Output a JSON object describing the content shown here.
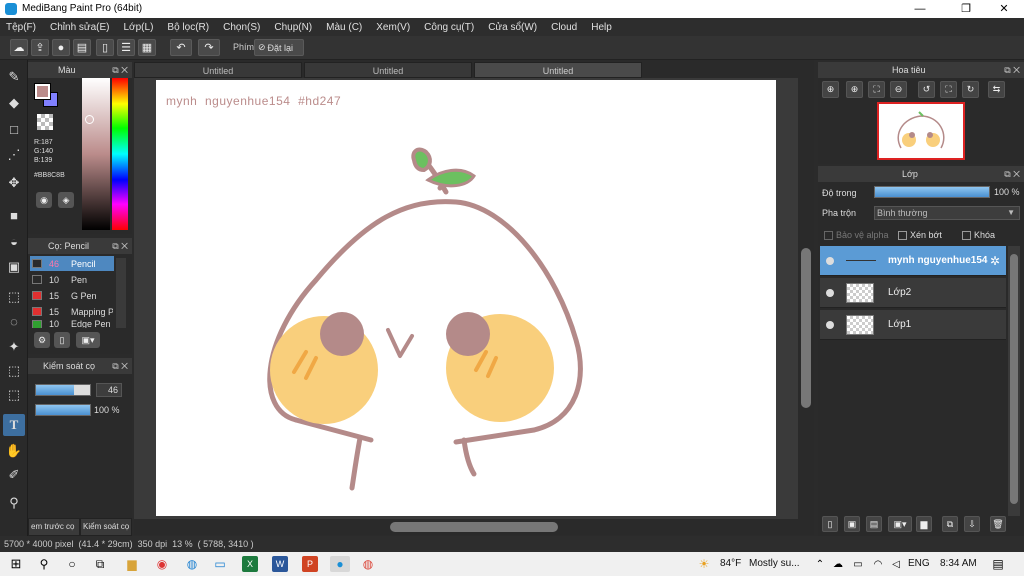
{
  "window": {
    "title": "MediBang Paint Pro (64bit)",
    "minimize_glyph": "—",
    "maximize_glyph": "❐",
    "close_glyph": "✕"
  },
  "menu": [
    "Tệp(F)",
    "Chỉnh sửa(E)",
    "Lớp(L)",
    "Bộ lọc(R)",
    "Chọn(S)",
    "Chụp(N)",
    "Màu (C)",
    "Xem(V)",
    "Công cụ(T)",
    "Cửa sổ(W)",
    "Cloud",
    "Help"
  ],
  "toolbar": {
    "shortcut_label": "Phím",
    "reset_label": "Đặt lại",
    "icons": [
      "cloud-icon",
      "upload-icon",
      "comment-icon",
      "chat-icon",
      "page-icon",
      "page-list-icon",
      "page-add-icon",
      "undo-icon",
      "redo-icon"
    ]
  },
  "doc_tabs": [
    "Untitled",
    "Untitled",
    "Untitled"
  ],
  "canvas": {
    "text": "mynh  nguyenhue154  #hd247"
  },
  "color_panel": {
    "title": "Màu",
    "r": "R:187",
    "g": "G:140",
    "b": "B:139",
    "hex": "#BB8C8B",
    "fg_color": "#bb8c8b",
    "bg_color": "#8080ff"
  },
  "brush_panel": {
    "title": "Cọ: Pencil",
    "brushes": [
      {
        "size": "46",
        "name": "Pencil",
        "color": "#2a2a2a"
      },
      {
        "size": "10",
        "name": "Pen",
        "color": "#2a2a2a"
      },
      {
        "size": "15",
        "name": "G Pen",
        "color": "#e03030"
      },
      {
        "size": "15",
        "name": "Mapping Pen",
        "color": "#e03030"
      },
      {
        "size": "10",
        "name": "Edge Pen",
        "color": "#30a030"
      }
    ]
  },
  "brush_control": {
    "title": "Kiểm soát cọ",
    "size_value": "46",
    "opacity_value": "100 %",
    "size_fraction": 0.7
  },
  "bottom_tabs": [
    "em trước cọ",
    "Kiểm soát cọ"
  ],
  "navigator": {
    "title": "Hoa tiêu"
  },
  "layers": {
    "title": "Lớp",
    "opacity_label": "Độ trong",
    "opacity_value": "100 %",
    "blend_label": "Pha trộn",
    "blend_value": "Bình thường",
    "protect_alpha": "Bảo vệ alpha",
    "clipping": "Xén bớt",
    "lock": "Khóa",
    "items": [
      {
        "name": "mynh  nguyenhue154",
        "selected": true
      },
      {
        "name": "Lớp2",
        "selected": false
      },
      {
        "name": "Lớp1",
        "selected": false
      }
    ]
  },
  "status": {
    "text": "5700 * 4000 pixel  (41.4 * 29cm)  350 dpi  13 %  ( 5788, 3410 )"
  },
  "taskbar": {
    "weather_temp": "84°F",
    "weather_text": "Mostly su...",
    "lang": "ENG",
    "time": "8:34 AM"
  }
}
